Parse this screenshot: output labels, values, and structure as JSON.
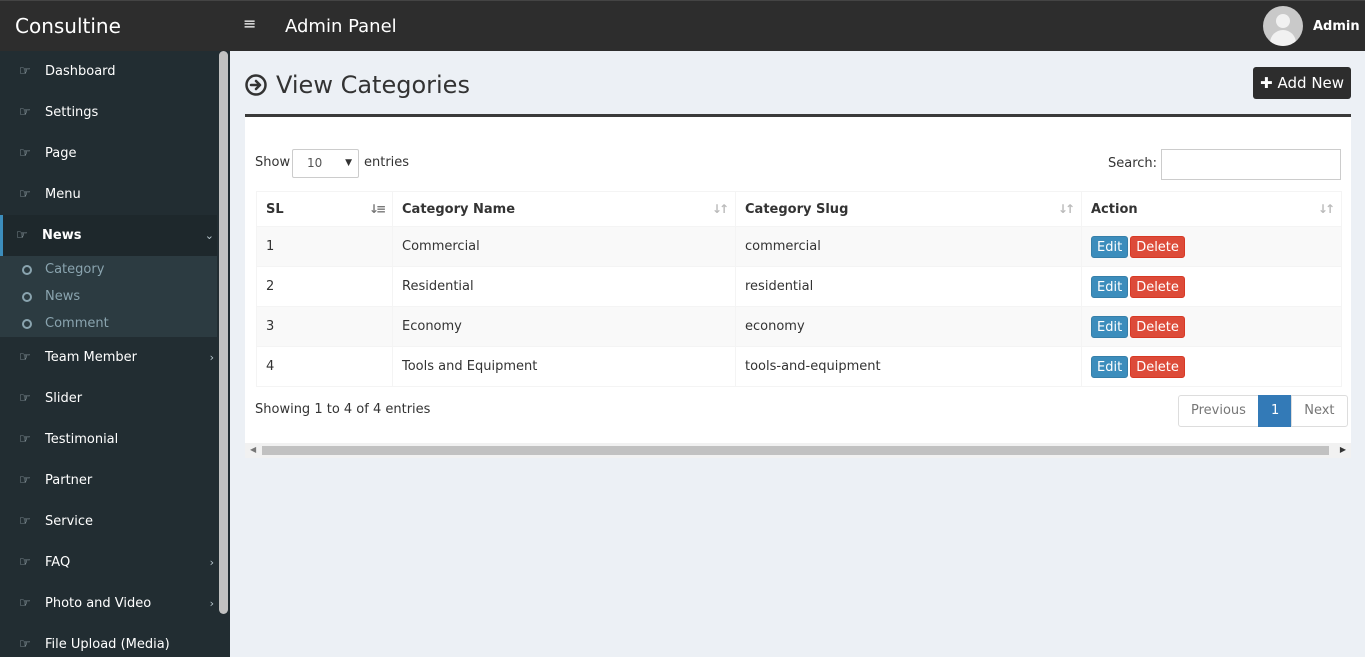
{
  "header": {
    "logo": "Consultine",
    "menu_icon": "hamburger-icon",
    "title": "Admin Panel",
    "user_name": "Admin"
  },
  "sidebar": {
    "items": [
      {
        "label": "Dashboard",
        "icon": "hand-pointer-icon"
      },
      {
        "label": "Settings",
        "icon": "hand-pointer-icon"
      },
      {
        "label": "Page",
        "icon": "hand-pointer-icon"
      },
      {
        "label": "Menu",
        "icon": "hand-pointer-icon"
      },
      {
        "label": "News",
        "icon": "hand-pointer-icon",
        "expanded": true
      },
      {
        "label": "Team Member",
        "icon": "hand-pointer-icon"
      },
      {
        "label": "Slider",
        "icon": "hand-pointer-icon"
      },
      {
        "label": "Testimonial",
        "icon": "hand-pointer-icon"
      },
      {
        "label": "Partner",
        "icon": "hand-pointer-icon"
      },
      {
        "label": "Service",
        "icon": "hand-pointer-icon"
      },
      {
        "label": "FAQ",
        "icon": "hand-pointer-icon"
      },
      {
        "label": "Photo and Video",
        "icon": "hand-pointer-icon"
      },
      {
        "label": "File Upload (Media)",
        "icon": "hand-pointer-icon"
      }
    ],
    "news_submenu": [
      {
        "label": "Category"
      },
      {
        "label": "News"
      },
      {
        "label": "Comment"
      }
    ]
  },
  "page": {
    "title": "View Categories",
    "add_button": "Add New"
  },
  "table_controls": {
    "show_label": "Show",
    "page_length": "10",
    "entries_label": "entries",
    "search_label": "Search:",
    "search_value": ""
  },
  "table": {
    "columns": [
      "SL",
      "Category Name",
      "Category Slug",
      "Action"
    ],
    "rows": [
      {
        "sl": "1",
        "name": "Commercial",
        "slug": "commercial"
      },
      {
        "sl": "2",
        "name": "Residential",
        "slug": "residential"
      },
      {
        "sl": "3",
        "name": "Economy",
        "slug": "economy"
      },
      {
        "sl": "4",
        "name": "Tools and Equipment",
        "slug": "tools-and-equipment"
      }
    ],
    "edit_label": "Edit",
    "delete_label": "Delete"
  },
  "footer": {
    "info": "Showing 1 to 4 of 4 entries",
    "previous": "Previous",
    "current_page": "1",
    "next": "Next"
  },
  "colors": {
    "header_bg": "#2d2d2d",
    "sidebar_bg": "#222d32",
    "edit_blue": "#3c8dbc",
    "delete_red": "#dd4b39",
    "page_active": "#337ab7"
  }
}
